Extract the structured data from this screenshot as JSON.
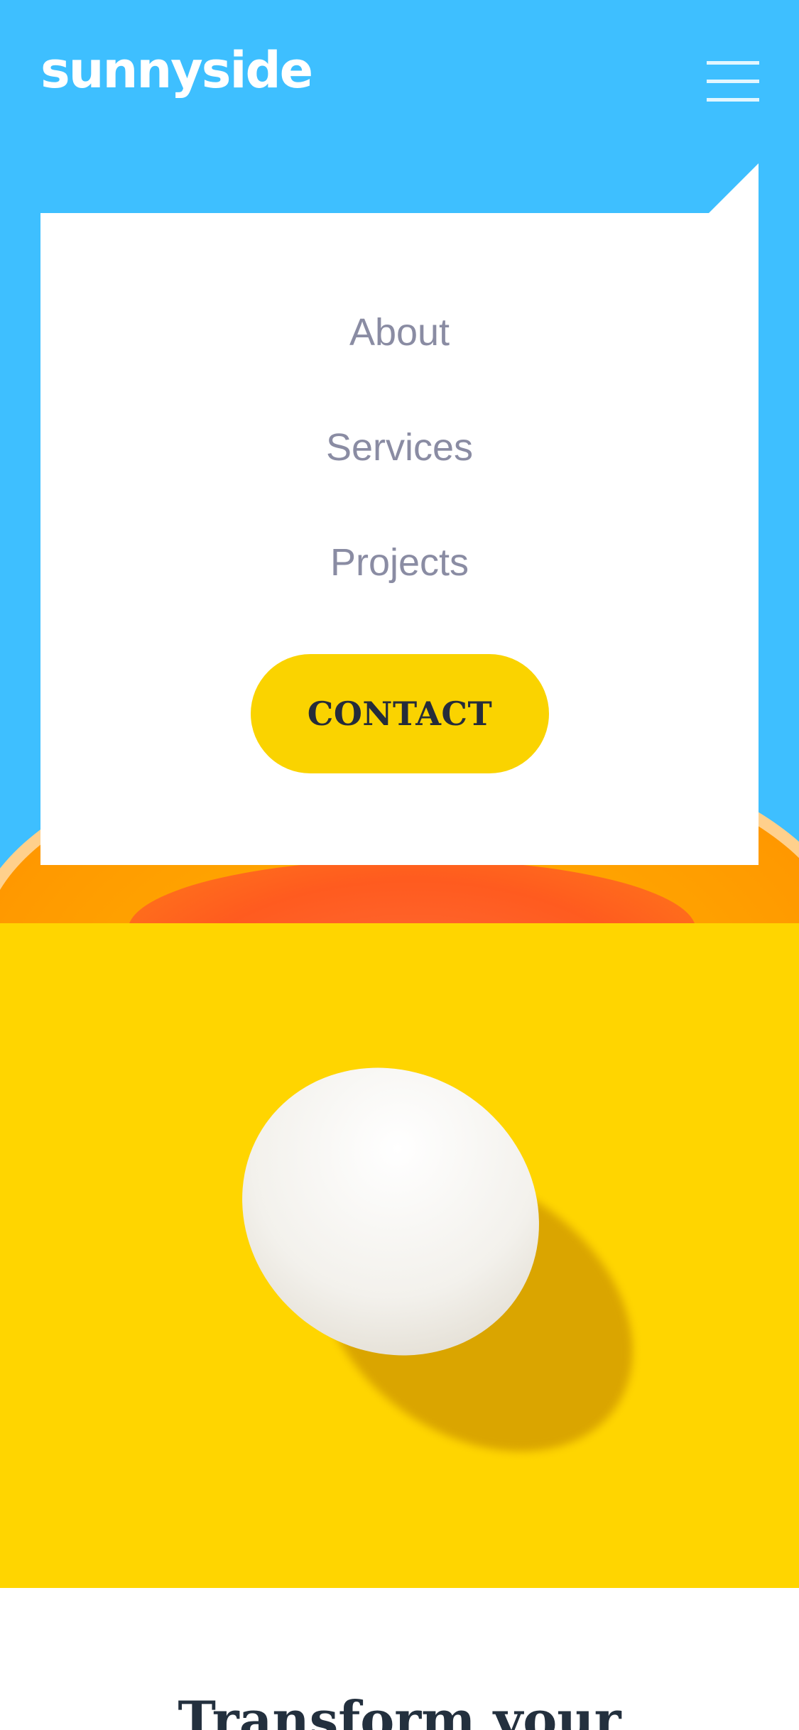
{
  "header": {
    "logo": "sunnyside",
    "menu_icon": "hamburger-menu-icon"
  },
  "menu": {
    "items": [
      "About",
      "Services",
      "Projects"
    ],
    "contact_label": "CONTACT"
  },
  "content": {
    "headline": "Transform your"
  },
  "colors": {
    "hero_blue": "#3ebfff",
    "menu_text": "#8a8ca3",
    "contact_bg": "#fad300",
    "contact_text": "#252c3a",
    "egg_bg": "#ffd500",
    "headline": "#23303e"
  }
}
